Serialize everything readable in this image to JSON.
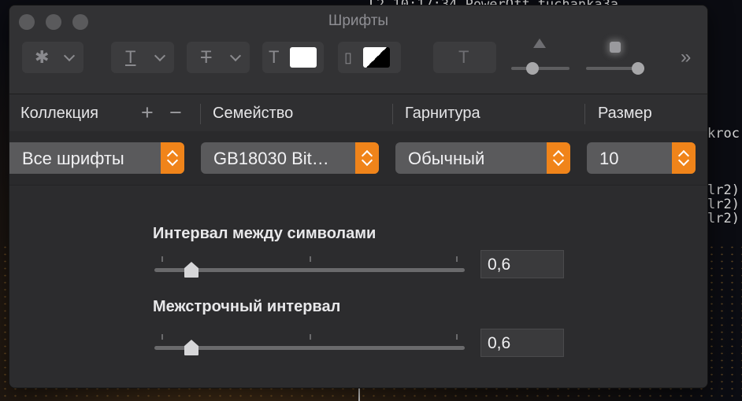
{
  "background": {
    "terminal_top": "2 10:17:34 PowerOff tuchanka3a",
    "terminal_right_1": "kroc",
    "terminal_right_2": "lr2)",
    "terminal_right_3": "lr2)",
    "terminal_right_4": "lr2)"
  },
  "window": {
    "title": "Шрифты"
  },
  "toolbar": {
    "action_icon": "gear-icon",
    "underline_icon": "underline-text-icon",
    "strikethrough_icon": "strikethrough-text-icon",
    "text_color_icon": "text-color-icon",
    "document_color_icon": "document-color-icon",
    "shadow_icon": "text-shadow-icon",
    "more_icon": "double-chevron-right-icon",
    "text_color": "#ffffff",
    "doc_color": "#000000"
  },
  "columns": {
    "collection": "Коллекция",
    "family": "Семейство",
    "typeface": "Гарнитура",
    "size": "Размер"
  },
  "selections": {
    "collection": "Все шрифты",
    "family": "GB18030 Bit…",
    "typeface": "Обычный",
    "size": "10"
  },
  "spacing": {
    "char_label": "Интервал между символами",
    "char_value": "0,6",
    "line_label": "Межстрочный интервал",
    "line_value": "0,6"
  },
  "colors": {
    "accent": "#f0841a",
    "window_bg": "#2c2c2e"
  }
}
